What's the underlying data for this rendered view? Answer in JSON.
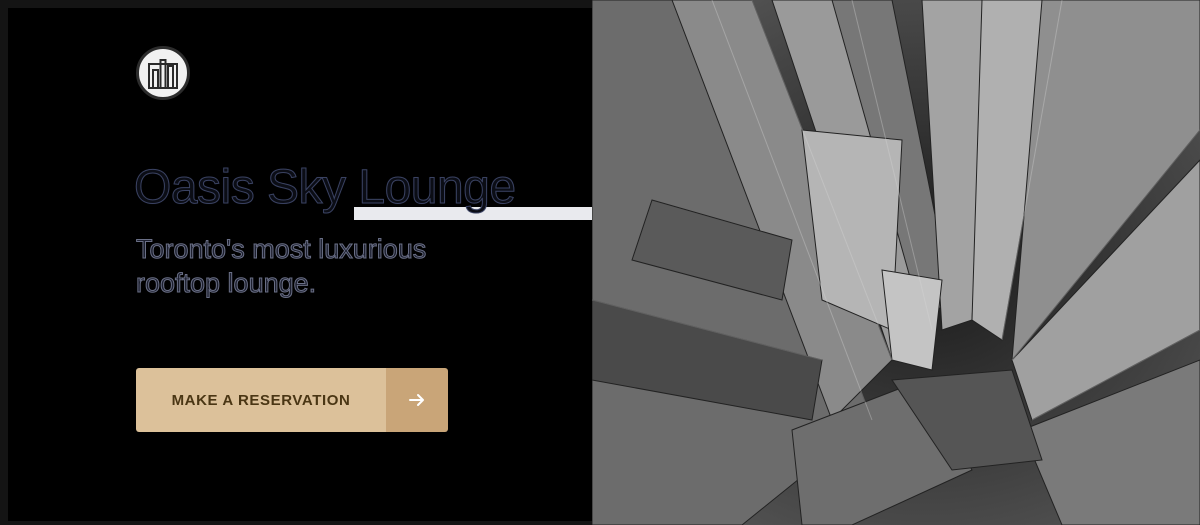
{
  "hero": {
    "title": "Oasis Sky Lounge",
    "subtitle": "Toronto's most luxurious rooftop lounge.",
    "cta_label": "MAKE A RESERVATION",
    "cta_icon": "arrow-right-icon",
    "logo_icon": "skyscraper-logo-icon"
  },
  "image": {
    "subject": "city-skyline-photo"
  },
  "colors": {
    "cta_bg": "#dcc19a",
    "cta_arrow_bg": "#c9a578",
    "cta_text": "#4a3614",
    "title": "#1f2538"
  }
}
